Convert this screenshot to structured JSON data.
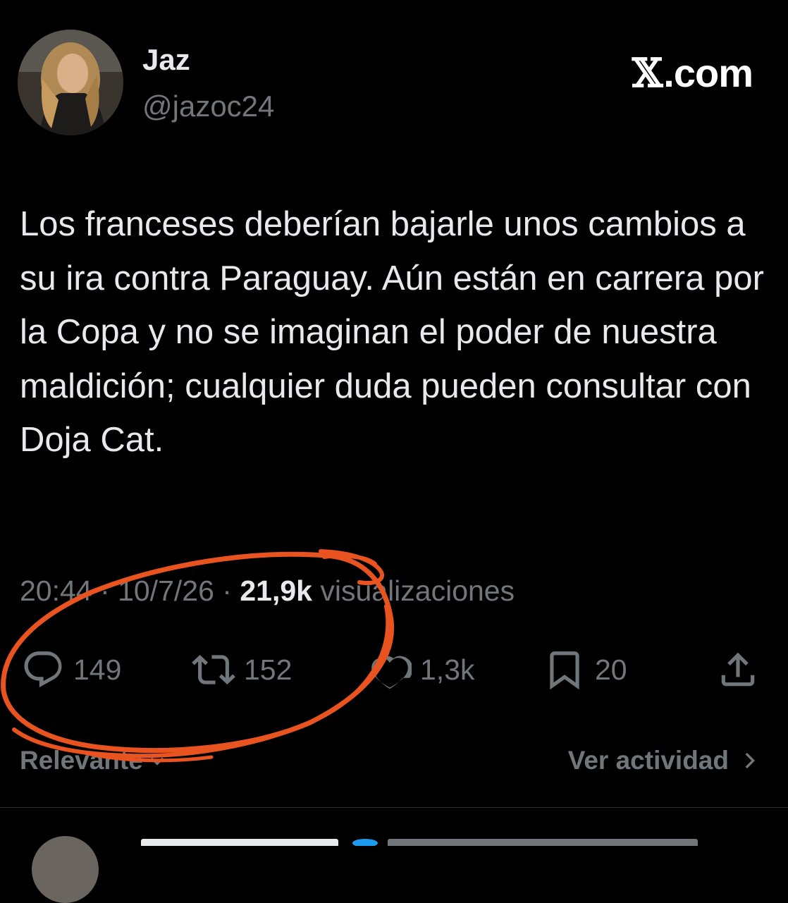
{
  "author": {
    "display_name": "Jaz",
    "handle": "@jazoc24"
  },
  "watermark": {
    "icon": "x-logo-icon",
    "text": ".com"
  },
  "tweet": {
    "text": "Los franceses deberían bajarle unos cambios a su ira contra Paraguay. Aún están en carrera por la Copa y no se imaginan el poder de nuestra maldición; cualquier duda pueden consultar con Doja Cat."
  },
  "meta": {
    "time": "20:44",
    "separator": "·",
    "date": "10/7/26",
    "views_count": "21,9k",
    "views_label": "visualizaciones"
  },
  "actions": {
    "replies": "149",
    "reposts": "152",
    "likes": "1,3k",
    "bookmarks": "20"
  },
  "footer": {
    "sort_label": "Relevante",
    "activity_label": "Ver actividad"
  },
  "colors": {
    "background": "#000000",
    "text": "#e7e9ea",
    "muted": "#71767b",
    "annotation": "#e8531f"
  }
}
